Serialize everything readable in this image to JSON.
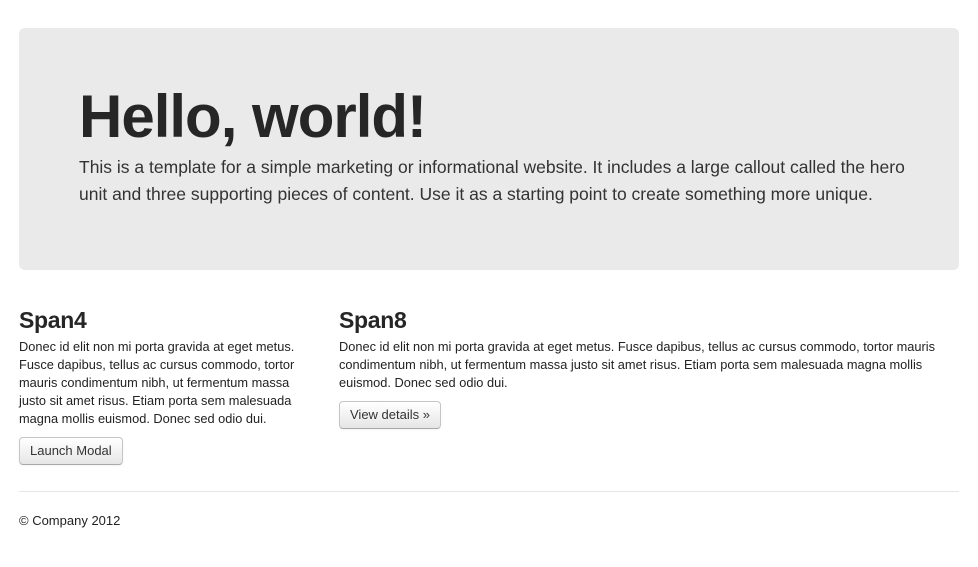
{
  "hero": {
    "title": "Hello, world!",
    "lead": "This is a template for a simple marketing or informational website. It includes a large callout called the hero unit and three supporting pieces of content. Use it as a starting point to create something more unique."
  },
  "columns": [
    {
      "title": "Span4",
      "text": "Donec id elit non mi porta gravida at eget metus. Fusce dapibus, tellus ac cursus commodo, tortor mauris condimentum nibh, ut fermentum massa justo sit amet risus. Etiam porta sem malesuada magna mollis euismod. Donec sed odio dui.",
      "button_label": "Launch Modal"
    },
    {
      "title": "Span8",
      "text": "Donec id elit non mi porta gravida at eget metus. Fusce dapibus, tellus ac cursus commodo, tortor mauris condimentum nibh, ut fermentum massa justo sit amet risus. Etiam porta sem malesuada magna mollis euismod. Donec sed odio dui.",
      "button_label": "View details »"
    }
  ],
  "footer": {
    "text": "© Company 2012"
  },
  "colors": {
    "hero_background": "#eaeaea",
    "text": "#333333",
    "heading": "#262626"
  }
}
